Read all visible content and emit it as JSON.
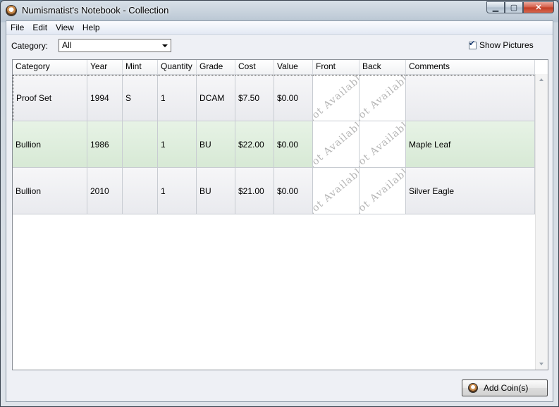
{
  "window": {
    "title": "Numismatist's Notebook - Collection",
    "buttons": {
      "minimize": "▁",
      "maximize": "▢",
      "close": "✕"
    }
  },
  "menu": [
    "File",
    "Edit",
    "View",
    "Help"
  ],
  "filter": {
    "label": "Category:",
    "selected": "All"
  },
  "show_pictures": {
    "label": "Show Pictures",
    "checked": true
  },
  "grid": {
    "columns": [
      "Category",
      "Year",
      "Mint",
      "Quantity",
      "Grade",
      "Cost",
      "Value",
      "Front",
      "Back",
      "Comments"
    ],
    "rows": [
      {
        "category": "Proof Set",
        "year": "1994",
        "mint": "S",
        "quantity": "1",
        "grade": "DCAM",
        "cost": "$7.50",
        "value": "$0.00",
        "front": "Not Available",
        "back": "Not Available",
        "comments": ""
      },
      {
        "category": "Bullion",
        "year": "1986",
        "mint": "",
        "quantity": "1",
        "grade": "BU",
        "cost": "$22.00",
        "value": "$0.00",
        "front": "Not Available",
        "back": "Not Available",
        "comments": "Maple Leaf"
      },
      {
        "category": "Bullion",
        "year": "2010",
        "mint": "",
        "quantity": "1",
        "grade": "BU",
        "cost": "$21.00",
        "value": "$0.00",
        "front": "Not Available",
        "back": "Not Available",
        "comments": "Silver Eagle"
      }
    ]
  },
  "add_button": {
    "label": "Add Coin(s)"
  }
}
